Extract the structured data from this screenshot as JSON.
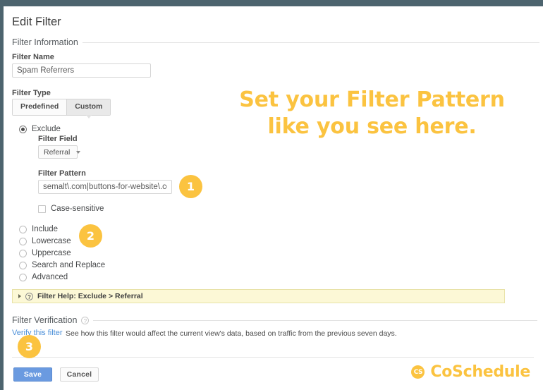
{
  "window": {
    "chrome_color": "#4d646e",
    "accent_color": "#fbc340",
    "primary_button_color": "#6a9ae0",
    "link_color": "#4d90d9"
  },
  "page": {
    "title": "Edit Filter"
  },
  "filter_information": {
    "section_label": "Filter Information",
    "name_label": "Filter Name",
    "name_value": "Spam Referrers",
    "name_placeholder": "Filter Name",
    "type_label": "Filter Type",
    "type_options": [
      {
        "label": "Predefined",
        "active": false
      },
      {
        "label": "Custom",
        "active": true
      }
    ]
  },
  "filter_types": {
    "exclude": {
      "label": "Exclude",
      "selected": true,
      "field_label": "Filter Field",
      "field_value": "Referral",
      "pattern_label": "Filter Pattern",
      "pattern_value": "semalt\\.com|buttons-for-website\\.com|bestw",
      "pattern_placeholder": "Filter Pattern",
      "case_sensitive_label": "Case-sensitive",
      "case_sensitive_checked": false
    },
    "others": [
      {
        "label": "Include",
        "selected": false
      },
      {
        "label": "Lowercase",
        "selected": false
      },
      {
        "label": "Uppercase",
        "selected": false
      },
      {
        "label": "Search and Replace",
        "selected": false
      },
      {
        "label": "Advanced",
        "selected": false
      }
    ]
  },
  "help_bar": {
    "icon": "question-mark-icon",
    "text": "Filter Help: Exclude  >  Referral"
  },
  "filter_verification": {
    "section_label": "Filter Verification",
    "help_icon": "question-mark-icon",
    "verify_link": "Verify this filter",
    "description": "See how this filter would affect the current view's data, based on traffic from the previous seven days."
  },
  "actions": {
    "save_label": "Save",
    "cancel_label": "Cancel"
  },
  "annotations": {
    "headline_line1": "Set your Filter Pattern",
    "headline_line2": "like you see here.",
    "badges": [
      {
        "number": "1"
      },
      {
        "number": "2"
      },
      {
        "number": "3"
      }
    ]
  },
  "brand": {
    "mark_text": "CS",
    "name": "CoSchedule"
  }
}
